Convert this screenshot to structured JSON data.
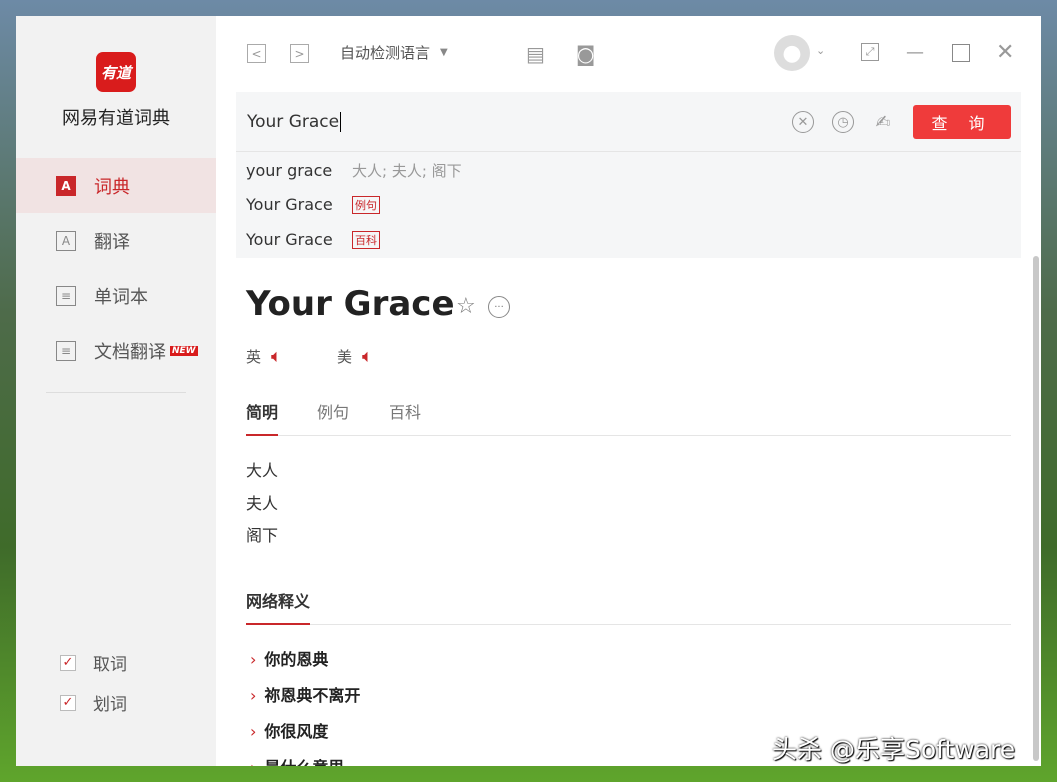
{
  "app": {
    "logo": "有道",
    "name": "网易有道词典"
  },
  "sidebar": {
    "items": [
      {
        "label": "词典",
        "icon": "dictionary-icon"
      },
      {
        "label": "翻译",
        "icon": "translate-icon"
      },
      {
        "label": "单词本",
        "icon": "wordbook-icon"
      },
      {
        "label": "文档翻译",
        "icon": "document-icon",
        "badge": "NEW"
      }
    ],
    "checkboxes": [
      {
        "label": "取词",
        "checked": true
      },
      {
        "label": "划词",
        "checked": true
      }
    ]
  },
  "toolbar": {
    "back": "<",
    "forward": ">",
    "language": "自动检测语言"
  },
  "search": {
    "query": "Your Grace",
    "button": "查 询"
  },
  "suggestions": [
    {
      "word": "your grace",
      "meaning": "大人; 夫人; 阁下"
    },
    {
      "word": "Your Grace",
      "tag": "例句"
    },
    {
      "word": "Your Grace",
      "tag": "百科"
    }
  ],
  "entry": {
    "word": "Your Grace",
    "uk": "英",
    "us": "美",
    "tabs": [
      "简明",
      "例句",
      "百科"
    ],
    "definitions": [
      "大人",
      "夫人",
      "阁下"
    ],
    "web_title": "网络释义",
    "web": [
      "你的恩典",
      "祢恩典不离开",
      "你很风度",
      "是什么意思"
    ]
  },
  "watermark": "头杀 @乐享Software",
  "colors": {
    "accent": "#c9272a",
    "button": "#ef3b3b"
  }
}
